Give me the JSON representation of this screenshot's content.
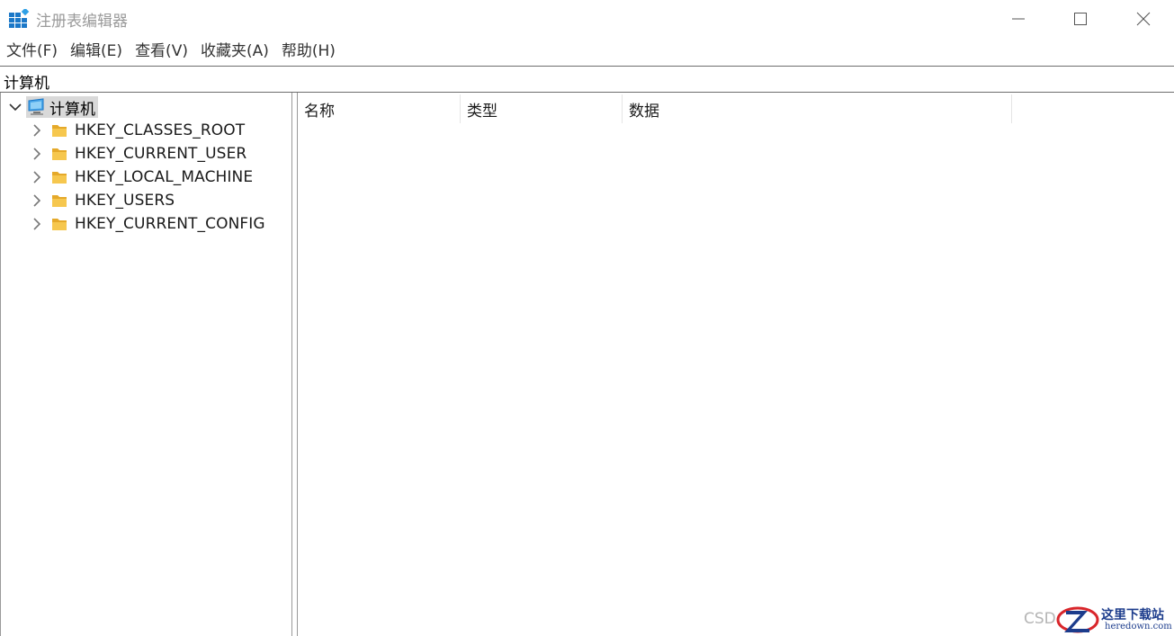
{
  "window": {
    "title": "注册表编辑器"
  },
  "menu": {
    "items": [
      "文件(F)",
      "编辑(E)",
      "查看(V)",
      "收藏夹(A)",
      "帮助(H)"
    ]
  },
  "address": {
    "path": "计算机"
  },
  "tree": {
    "root": {
      "label": "计算机",
      "icon": "computer-icon",
      "expanded": true,
      "selected": true
    },
    "children": [
      {
        "label": "HKEY_CLASSES_ROOT",
        "icon": "folder-icon"
      },
      {
        "label": "HKEY_CURRENT_USER",
        "icon": "folder-icon"
      },
      {
        "label": "HKEY_LOCAL_MACHINE",
        "icon": "folder-icon"
      },
      {
        "label": "HKEY_USERS",
        "icon": "folder-icon"
      },
      {
        "label": "HKEY_CURRENT_CONFIG",
        "icon": "folder-icon"
      }
    ]
  },
  "list": {
    "columns": [
      "名称",
      "类型",
      "数据"
    ]
  },
  "watermark": {
    "prefix": "CSD",
    "title": "这里下载站",
    "url": "heredown.com"
  },
  "colors": {
    "title_text": "#9a9a9a",
    "folder_yellow": "#f6c74e",
    "selection_bg": "#d9d9d9",
    "accent_blue": "#1b78c8",
    "watermark_blue": "#1c3c8c",
    "watermark_red": "#d9262b"
  }
}
